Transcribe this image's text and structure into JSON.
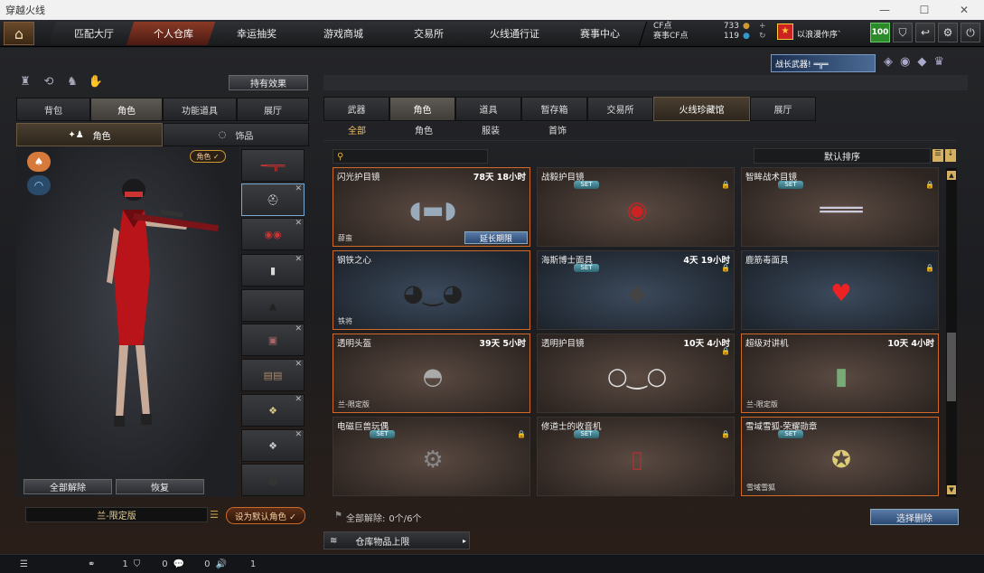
{
  "window": {
    "title": "穿越火线",
    "controls": [
      "—",
      "☐",
      "✕"
    ]
  },
  "topnav": {
    "tabs": [
      "匹配大厅",
      "个人仓库",
      "幸运抽奖",
      "游戏商城",
      "交易所",
      "火线通行证",
      "赛事中心"
    ],
    "active": 1,
    "cf_label": "CF点",
    "cf_value": "733",
    "game_cf_label": "赛事CF点",
    "game_cf_value": "119",
    "user": "以浪漫作序`",
    "level": "100"
  },
  "left": {
    "effect_btn": "持有效果",
    "tabs": [
      "背包",
      "角色",
      "功能道具",
      "展厅"
    ],
    "active_tab": 1,
    "subtabs": [
      "角色",
      "饰品"
    ],
    "active_sub": 0,
    "role_filter": "角色 ✓",
    "unequip_all": "全部解除",
    "restore": "恢复",
    "char_name": "兰-限定版",
    "set_default": "设为默认角色 ✓"
  },
  "right": {
    "tabs": [
      "武器",
      "角色",
      "道具",
      "暂存箱",
      "交易所",
      "火线珍藏馆",
      "展厅"
    ],
    "active_tab": 1,
    "subtabs": [
      "全部",
      "角色",
      "服装",
      "首饰"
    ],
    "active_sub": 0,
    "sort": "默认排序",
    "search_placeholder": "",
    "items": [
      {
        "name": "闪光护目镜",
        "time": "78天 18小时",
        "set": false,
        "lock": false,
        "tag": "薛蛮",
        "ext": "延长期限",
        "style": "brown",
        "sel": true,
        "icon": "goggles"
      },
      {
        "name": "战毅护目镜",
        "time": "",
        "set": true,
        "lock": true,
        "tag": "",
        "ext": "",
        "style": "brown",
        "sel": false,
        "icon": "mask-red"
      },
      {
        "name": "智眸战术目镜",
        "time": "",
        "set": true,
        "lock": true,
        "tag": "",
        "ext": "",
        "style": "brown",
        "sel": false,
        "icon": "visor"
      },
      {
        "name": "钢铁之心",
        "time": "",
        "set": false,
        "lock": false,
        "tag": "铁将",
        "ext": "",
        "style": "blue",
        "sel": true,
        "icon": "sunglasses"
      },
      {
        "name": "海斯博士面具",
        "time": "4天 19小时",
        "set": true,
        "lock": true,
        "tag": "",
        "ext": "",
        "style": "blue",
        "sel": false,
        "icon": "mask-dark"
      },
      {
        "name": "鹿筋毒面具",
        "time": "",
        "set": false,
        "lock": true,
        "tag": "",
        "ext": "",
        "style": "blue",
        "sel": false,
        "icon": "mask-heart"
      },
      {
        "name": "透明头盔",
        "time": "39天 5小时",
        "set": false,
        "lock": false,
        "tag": "兰-限定版",
        "ext": "",
        "style": "brown",
        "sel": true,
        "icon": "helmet"
      },
      {
        "name": "透明护目镜",
        "time": "10天 4小时",
        "set": false,
        "lock": true,
        "tag": "",
        "ext": "",
        "style": "brown",
        "sel": false,
        "icon": "clear-goggles"
      },
      {
        "name": "超级对讲机",
        "time": "10天 4小时",
        "set": false,
        "lock": false,
        "tag": "兰-限定版",
        "ext": "",
        "style": "brown",
        "sel": true,
        "icon": "radio"
      },
      {
        "name": "电磁巨兽玩偶",
        "time": "",
        "set": true,
        "lock": true,
        "tag": "",
        "ext": "",
        "style": "brown",
        "sel": false,
        "icon": "mech"
      },
      {
        "name": "修道士的收音机",
        "time": "",
        "set": true,
        "lock": true,
        "tag": "",
        "ext": "",
        "style": "brown",
        "sel": false,
        "icon": "walkie"
      },
      {
        "name": "雪域雪狐-荣耀勋章",
        "time": "",
        "set": true,
        "lock": false,
        "tag": "雪域雪狐",
        "ext": "",
        "style": "brown",
        "sel": true,
        "icon": "medal"
      }
    ],
    "unequip_label": "全部解除:",
    "unequip_count": "0个/6个",
    "select_delete": "选择删除",
    "warehouse_limit": "仓库物品上限"
  },
  "status": {
    "friends": "1",
    "clan": "0",
    "msg": "0",
    "voice": "1"
  }
}
